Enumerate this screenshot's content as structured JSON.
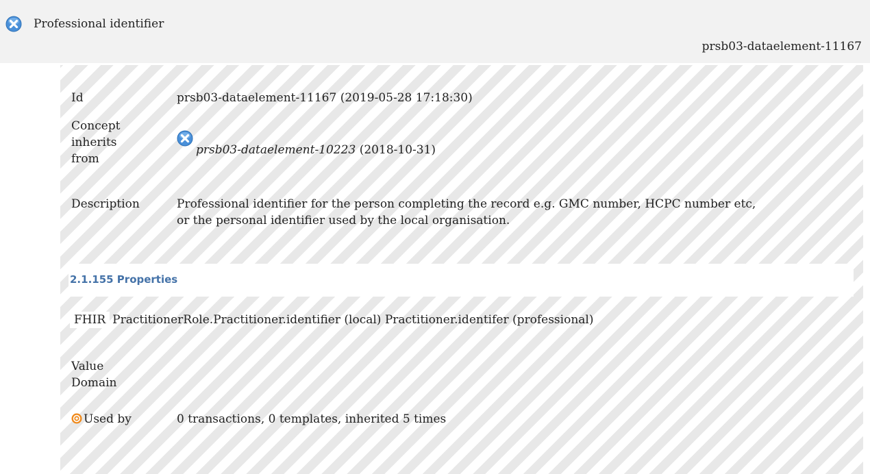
{
  "header": {
    "title": "Professional identifier",
    "id_ref": "prsb03-dataelement-11167"
  },
  "details": {
    "id_label": "Id",
    "id_value": "prsb03-dataelement-11167 (2019-05-28 17:18:30)",
    "concept_label_1": "Concept",
    "concept_label_2": "inherits",
    "concept_label_3": "from",
    "concept_ref": "prsb03-dataelement-10223",
    "concept_date": "(2018-10-31)",
    "description_label": "Description",
    "description_line_1": "Professional identifier for the person completing the record e.g. GMC number, HCPC number etc,",
    "description_line_2": "or the personal identifier used by the local organisation."
  },
  "properties": {
    "heading": "2.1.155 Properties",
    "fhir_label": "FHIR",
    "fhir_value": "PractitionerRole.Practitioner.identifier (local) Practitioner.identifer (professional)",
    "value_domain_label_1": "Value",
    "value_domain_label_2": "Domain",
    "used_by_label": "Used by",
    "used_by_value": "0 transactions, 0 templates, inherited 5 times"
  },
  "colors": {
    "header_bg": "#f2f2f2",
    "status_icon": "#4a90d9",
    "section_heading": "#4472a8",
    "used_by_icon": "#f08a1c"
  },
  "icons": {
    "status": "deprecated-status-icon",
    "used_by": "target-icon"
  }
}
